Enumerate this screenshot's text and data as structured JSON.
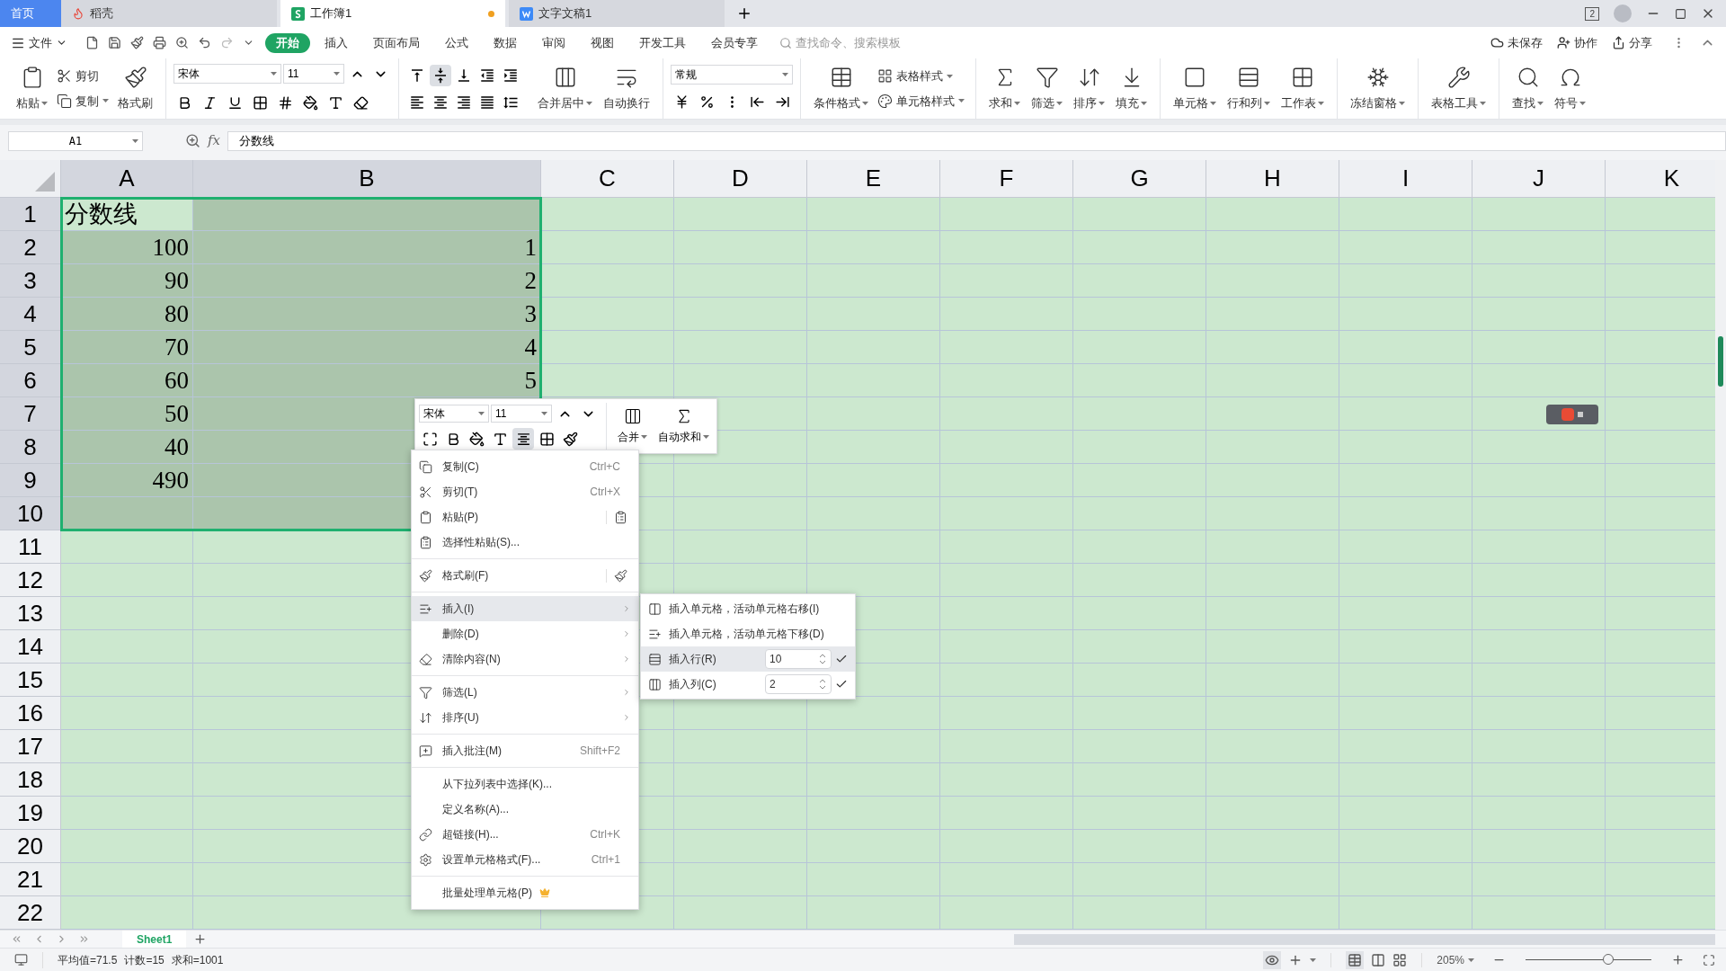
{
  "title_bar": {
    "tabs": [
      {
        "label": "首页",
        "kind": "home",
        "selected": false,
        "modified": false
      },
      {
        "label": "稻壳",
        "kind": "docer",
        "selected": false,
        "modified": false
      },
      {
        "label": "工作簿1",
        "kind": "sheet",
        "selected": true,
        "modified": true
      },
      {
        "label": "文字文稿1",
        "kind": "doc",
        "selected": false,
        "modified": false
      }
    ],
    "window_count": "2"
  },
  "menu_bar": {
    "file": "文件",
    "tabs": [
      {
        "label": "开始",
        "selected": true
      },
      {
        "label": "插入",
        "selected": false
      },
      {
        "label": "页面布局",
        "selected": false
      },
      {
        "label": "公式",
        "selected": false
      },
      {
        "label": "数据",
        "selected": false
      },
      {
        "label": "审阅",
        "selected": false
      },
      {
        "label": "视图",
        "selected": false
      },
      {
        "label": "开发工具",
        "selected": false
      },
      {
        "label": "会员专享",
        "selected": false
      }
    ],
    "search": {
      "placeholder": "查找命令、搜索模板"
    },
    "actions": [
      "未保存",
      "协作",
      "分享"
    ]
  },
  "ribbon": {
    "clipboard": [
      {
        "label": "粘贴",
        "kind": "large",
        "dropdown": true
      },
      {
        "label": "剪切",
        "kind": "small",
        "dropdown": false
      },
      {
        "label": "复制",
        "kind": "small",
        "dropdown": true
      },
      {
        "label": "格式刷",
        "kind": "large",
        "dropdown": false
      }
    ],
    "font": {
      "name": "宋体",
      "size": "11"
    },
    "align_buttons": [
      {
        "selected": false
      },
      {
        "selected": true
      },
      {
        "selected": false
      },
      {
        "selected": false
      },
      {
        "selected": false
      },
      {
        "selected": false
      },
      {
        "selected": false
      },
      {
        "selected": false
      },
      {
        "selected": false
      },
      {
        "selected": false
      }
    ],
    "alignment": [
      {
        "label": "合并居中",
        "kind": "large",
        "dropdown": true
      },
      {
        "label": "自动换行",
        "kind": "large",
        "dropdown": false
      }
    ],
    "number_format": "常规",
    "styles": [
      {
        "label": "条件格式",
        "kind": "large",
        "dropdown": true
      },
      {
        "label": "表格样式",
        "kind": "small",
        "dropdown": true
      },
      {
        "label": "单元格样式",
        "kind": "small",
        "dropdown": true
      }
    ],
    "editing": [
      {
        "label": "求和",
        "kind": "large",
        "dropdown": true
      },
      {
        "label": "筛选",
        "kind": "large",
        "dropdown": true
      },
      {
        "label": "排序",
        "kind": "large",
        "dropdown": true
      },
      {
        "label": "填充",
        "kind": "large",
        "dropdown": true
      }
    ],
    "cells": [
      {
        "label": "单元格",
        "kind": "large",
        "dropdown": true
      },
      {
        "label": "行和列",
        "kind": "large",
        "dropdown": true
      },
      {
        "label": "工作表",
        "kind": "large",
        "dropdown": true
      }
    ],
    "view": [
      {
        "label": "冻结窗格",
        "kind": "large",
        "dropdown": true
      }
    ],
    "tools": [
      {
        "label": "表格工具",
        "kind": "large",
        "dropdown": true
      }
    ],
    "find": [
      {
        "label": "查找",
        "kind": "large",
        "dropdown": true
      },
      {
        "label": "符号",
        "kind": "large",
        "dropdown": true
      }
    ]
  },
  "formula_bar": {
    "name_box": "A1",
    "fx": "fx",
    "formula": "分数线"
  },
  "sheet": {
    "columns": [
      {
        "label": "A",
        "selected": true
      },
      {
        "label": "B",
        "selected": true
      },
      {
        "label": "C",
        "selected": false
      },
      {
        "label": "D",
        "selected": false
      },
      {
        "label": "E",
        "selected": false
      },
      {
        "label": "F",
        "selected": false
      },
      {
        "label": "G",
        "selected": false
      },
      {
        "label": "H",
        "selected": false
      },
      {
        "label": "I",
        "selected": false
      },
      {
        "label": "J",
        "selected": false
      },
      {
        "label": "K",
        "selected": false
      }
    ],
    "rows": [
      {
        "label": "1",
        "selected": true,
        "cells": [
          {
            "value": "分数线",
            "kind": "text",
            "active": true
          }
        ]
      },
      {
        "label": "2",
        "selected": true,
        "cells": [
          {
            "value": "100",
            "kind": "number",
            "active": false
          },
          {
            "value": "1",
            "kind": "number",
            "active": false
          }
        ]
      },
      {
        "label": "3",
        "selected": true,
        "cells": [
          {
            "value": "90",
            "kind": "number",
            "active": false
          },
          {
            "value": "2",
            "kind": "number",
            "active": false
          }
        ]
      },
      {
        "label": "4",
        "selected": true,
        "cells": [
          {
            "value": "80",
            "kind": "number",
            "active": false
          },
          {
            "value": "3",
            "kind": "number",
            "active": false
          }
        ]
      },
      {
        "label": "5",
        "selected": true,
        "cells": [
          {
            "value": "70",
            "kind": "number",
            "active": false
          },
          {
            "value": "4",
            "kind": "number",
            "active": false
          }
        ]
      },
      {
        "label": "6",
        "selected": true,
        "cells": [
          {
            "value": "60",
            "kind": "number",
            "active": false
          },
          {
            "value": "5",
            "kind": "number",
            "active": false
          }
        ]
      },
      {
        "label": "7",
        "selected": true,
        "cells": [
          {
            "value": "50",
            "kind": "number",
            "active": false
          }
        ]
      },
      {
        "label": "8",
        "selected": true,
        "cells": [
          {
            "value": "40",
            "kind": "number",
            "active": false
          }
        ]
      },
      {
        "label": "9",
        "selected": true,
        "cells": [
          {
            "value": "490",
            "kind": "number",
            "active": false
          }
        ]
      },
      {
        "label": "10",
        "selected": true
      },
      {
        "label": "11",
        "selected": false
      },
      {
        "label": "12",
        "selected": false
      },
      {
        "label": "13",
        "selected": false
      },
      {
        "label": "14",
        "selected": false
      },
      {
        "label": "15",
        "selected": false
      },
      {
        "label": "16",
        "selected": false
      },
      {
        "label": "17",
        "selected": false
      },
      {
        "label": "18",
        "selected": false
      },
      {
        "label": "19",
        "selected": false
      },
      {
        "label": "20",
        "selected": false
      },
      {
        "label": "21",
        "selected": false
      },
      {
        "label": "22",
        "selected": false
      }
    ]
  },
  "mini_toolbar": {
    "font": "宋体",
    "size": "11",
    "align_selected": true,
    "buttons": [
      {
        "label": "合并"
      },
      {
        "label": "自动求和"
      }
    ]
  },
  "context_menu": {
    "groups": [
      [
        {
          "label": "复制(C)",
          "kind": "shortcut",
          "shortcut": "Ctrl+C",
          "selected": false
        },
        {
          "label": "剪切(T)",
          "kind": "shortcut",
          "shortcut": "Ctrl+X",
          "selected": false
        },
        {
          "label": "粘贴(P)",
          "kind": "side-button",
          "selected": false
        },
        {
          "label": "选择性粘贴(S)...",
          "kind": "plain",
          "selected": false
        }
      ],
      [
        {
          "label": "格式刷(F)",
          "kind": "side-button",
          "selected": false
        }
      ],
      [
        {
          "label": "插入(I)",
          "kind": "submenu",
          "selected": true
        },
        {
          "label": "删除(D)",
          "kind": "submenu",
          "selected": false
        },
        {
          "label": "清除内容(N)",
          "kind": "submenu",
          "selected": false
        }
      ],
      [
        {
          "label": "筛选(L)",
          "kind": "submenu",
          "selected": false
        },
        {
          "label": "排序(U)",
          "kind": "submenu",
          "selected": false
        }
      ],
      [
        {
          "label": "插入批注(M)",
          "kind": "shortcut",
          "shortcut": "Shift+F2",
          "selected": false
        }
      ],
      [
        {
          "label": "从下拉列表中选择(K)...",
          "kind": "plain",
          "selected": false
        },
        {
          "label": "定义名称(A)...",
          "kind": "plain",
          "selected": false
        },
        {
          "label": "超链接(H)...",
          "kind": "shortcut",
          "shortcut": "Ctrl+K",
          "selected": false
        },
        {
          "label": "设置单元格格式(F)...",
          "kind": "shortcut",
          "shortcut": "Ctrl+1",
          "selected": false
        }
      ],
      [
        {
          "label": "批量处理单元格(P)",
          "kind": "member",
          "selected": false
        }
      ]
    ]
  },
  "submenu": {
    "items": [
      {
        "label": "插入单元格，活动单元格右移(I)",
        "kind": "command",
        "selected": false
      },
      {
        "label": "插入单元格，活动单元格下移(D)",
        "kind": "command",
        "selected": false
      },
      {
        "label": "插入行(R)",
        "kind": "count",
        "value": "10",
        "selected": true
      },
      {
        "label": "插入列(C)",
        "kind": "count",
        "value": "2",
        "selected": false
      }
    ]
  },
  "sheet_tabs": [
    {
      "label": "Sheet1",
      "selected": true
    }
  ],
  "status_bar": {
    "stats": [
      "平均值=71.5",
      "计数=15",
      "求和=1001"
    ],
    "zoom": "205%",
    "zoom_slider": {
      "level": 0.66
    }
  }
}
